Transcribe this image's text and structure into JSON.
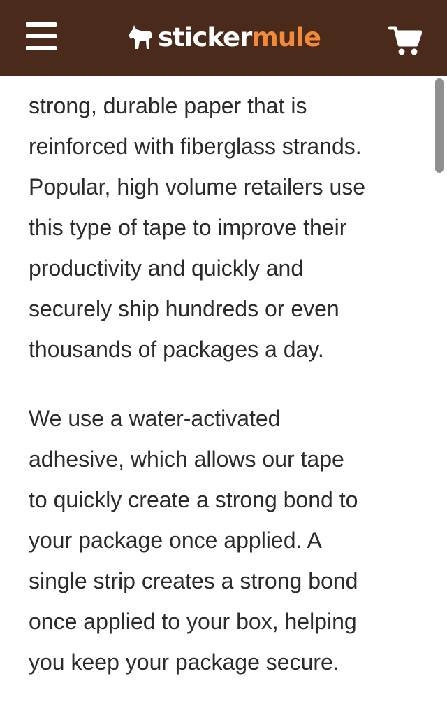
{
  "header": {
    "logo": {
      "part1": "sticker",
      "part2": "mule"
    },
    "menu_icon": "hamburger-menu-icon",
    "cart_icon": "shopping-cart-icon",
    "colors": {
      "background": "#4a2a1a",
      "accent": "#f28a3a",
      "text": "#ffffff"
    }
  },
  "article": {
    "paragraphs": [
      "strong, durable paper that is\nreinforced with fiberglass strands.\nPopular, high volume retailers use\nthis type of tape to improve their\nproductivity and quickly and\nsecurely ship hundreds or even\nthousands of packages a day.",
      "We use a water-activated\nadhesive, which allows our tape\nto quickly create a strong bond to\nyour package once applied. A\nsingle strip creates a strong bond\nonce applied to your box, helping\nyou keep your package secure."
    ]
  }
}
